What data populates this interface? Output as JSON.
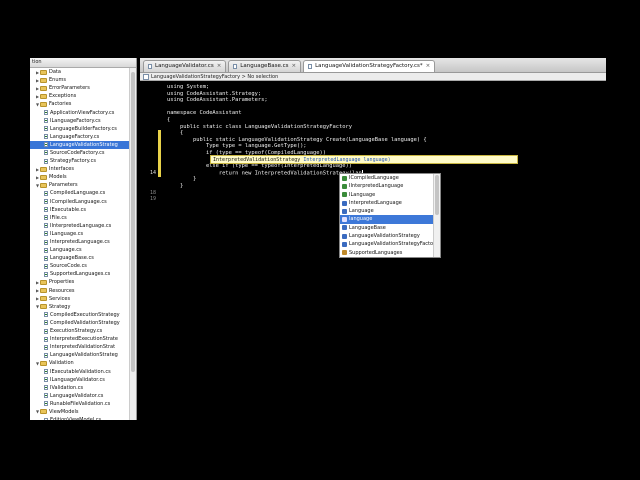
{
  "sidebar": {
    "header": "tion",
    "items": [
      {
        "label": "Data",
        "type": "folder",
        "indent": 1,
        "expander": "▶"
      },
      {
        "label": "Enums",
        "type": "folder",
        "indent": 1,
        "expander": "▶"
      },
      {
        "label": "ErrorParameters",
        "type": "folder",
        "indent": 1,
        "expander": "▶"
      },
      {
        "label": "Exceptions",
        "type": "folder",
        "indent": 1,
        "expander": "▶"
      },
      {
        "label": "Factories",
        "type": "folder",
        "indent": 1,
        "expander": "▼"
      },
      {
        "label": "ApplicationViewFactory.cs",
        "type": "file",
        "indent": 2
      },
      {
        "label": "ILanguageFactory.cs",
        "type": "file",
        "indent": 2
      },
      {
        "label": "LanguageBuilderFactory.cs",
        "type": "file",
        "indent": 2
      },
      {
        "label": "LanguageFactory.cs",
        "type": "file",
        "indent": 2
      },
      {
        "label": "LanguageValidationStrateg",
        "type": "file",
        "indent": 2,
        "selected": true
      },
      {
        "label": "SourceCodeFactory.cs",
        "type": "file",
        "indent": 2
      },
      {
        "label": "StrategyFactory.cs",
        "type": "file",
        "indent": 2
      },
      {
        "label": "Interfaces",
        "type": "folder",
        "indent": 1,
        "expander": "▶"
      },
      {
        "label": "Models",
        "type": "folder",
        "indent": 1,
        "expander": "▶"
      },
      {
        "label": "Parameters",
        "type": "folder",
        "indent": 1,
        "expander": "▼"
      },
      {
        "label": "CompiledLanguage.cs",
        "type": "file",
        "indent": 2
      },
      {
        "label": "ICompiledLanguage.cs",
        "type": "file",
        "indent": 2
      },
      {
        "label": "IExecutable.cs",
        "type": "file",
        "indent": 2
      },
      {
        "label": "IFile.cs",
        "type": "file",
        "indent": 2
      },
      {
        "label": "IInterpretedLanguage.cs",
        "type": "file",
        "indent": 2
      },
      {
        "label": "ILanguage.cs",
        "type": "file",
        "indent": 2
      },
      {
        "label": "InterpretedLanguage.cs",
        "type": "file",
        "indent": 2
      },
      {
        "label": "Language.cs",
        "type": "file",
        "indent": 2
      },
      {
        "label": "LanguageBase.cs",
        "type": "file",
        "indent": 2
      },
      {
        "label": "SourceCode.cs",
        "type": "file",
        "indent": 2
      },
      {
        "label": "SupportedLanguages.cs",
        "type": "file",
        "indent": 2
      },
      {
        "label": "Properties",
        "type": "folder",
        "indent": 1,
        "expander": "▶"
      },
      {
        "label": "Resources",
        "type": "folder",
        "indent": 1,
        "expander": "▶"
      },
      {
        "label": "Services",
        "type": "folder",
        "indent": 1,
        "expander": "▶"
      },
      {
        "label": "Strategy",
        "type": "folder",
        "indent": 1,
        "expander": "▼"
      },
      {
        "label": "CompiledExecutionStrategy",
        "type": "file",
        "indent": 2
      },
      {
        "label": "CompiledValidationStrategy",
        "type": "file",
        "indent": 2
      },
      {
        "label": "ExecutionStrategy.cs",
        "type": "file",
        "indent": 2
      },
      {
        "label": "InterpretedExecutionStrate",
        "type": "file",
        "indent": 2
      },
      {
        "label": "InterpretedValidationStrat",
        "type": "file",
        "indent": 2
      },
      {
        "label": "LanguageValidationStrateg",
        "type": "file",
        "indent": 2
      },
      {
        "label": "Validation",
        "type": "folder",
        "indent": 1,
        "expander": "▼"
      },
      {
        "label": "IExecutableValidation.cs",
        "type": "file",
        "indent": 2
      },
      {
        "label": "ILanguageValidator.cs",
        "type": "file",
        "indent": 2
      },
      {
        "label": "IValidation.cs",
        "type": "file",
        "indent": 2
      },
      {
        "label": "LanguageValidator.cs",
        "type": "file",
        "indent": 2
      },
      {
        "label": "RunableFileValidation.cs",
        "type": "file",
        "indent": 2
      },
      {
        "label": "ViewModels",
        "type": "folder",
        "indent": 1,
        "expander": "▼"
      },
      {
        "label": "EditionViewModel.cs",
        "type": "file",
        "indent": 2
      }
    ]
  },
  "tabs": [
    {
      "label": "LanguageValidator.cs",
      "active": false
    },
    {
      "label": "LanguageBase.cs",
      "active": false
    },
    {
      "label": "LanguageValidationStrategyFactory.cs*",
      "active": true
    }
  ],
  "pathbar": "LanguageValidationStrategyFactory > No selection",
  "editor": {
    "lines": [
      {
        "num": "",
        "text": "using System;",
        "mark": false
      },
      {
        "num": "",
        "text": "using CodeAssistant.Strategy;",
        "mark": false
      },
      {
        "num": "",
        "text": "using CodeAssistant.Parameters;",
        "mark": false
      },
      {
        "num": "",
        "text": "",
        "mark": false
      },
      {
        "num": "",
        "text": "namespace CodeAssistant",
        "mark": false
      },
      {
        "num": "",
        "text": "{",
        "mark": false
      },
      {
        "num": "",
        "text": "    public static class LanguageValidationStrategyFactory",
        "mark": false
      },
      {
        "num": "",
        "text": "    {",
        "mark": true
      },
      {
        "num": "",
        "text": "        public static LanguageValidationStrategy Create(LanguageBase language) {",
        "mark": true
      },
      {
        "num": "",
        "text": "            Type type = language.GetType();",
        "mark": true
      },
      {
        "num": "",
        "text": "            if (type == typeof(CompiledLanguage))",
        "mark": true
      },
      {
        "num": "",
        "text": "                return new CompiledValidationStrategy(lan",
        "mark": true
      },
      {
        "num": "",
        "text": "            else if (type == typeof(InterpretedLanguage))",
        "mark": true
      },
      {
        "num": "14",
        "text": "                return new InterpretedValidationStrategy(lan",
        "mark": true,
        "current": true
      },
      {
        "num": "",
        "text": "        }",
        "mark": false
      },
      {
        "num": "",
        "text": "    }",
        "mark": false
      },
      {
        "num": "18",
        "text": "",
        "mark": false
      },
      {
        "num": "19",
        "text": "",
        "mark": false
      }
    ]
  },
  "tooltip": {
    "main": "InterpretedValidationStrategy",
    "param": "InterpretedLanguage language)"
  },
  "autocomplete": [
    {
      "label": "ICompiledLanguage",
      "icon_color": "#3a8c3a"
    },
    {
      "label": "IInterpretedLanguage",
      "icon_color": "#3a8c3a"
    },
    {
      "label": "ILanguage",
      "icon_color": "#3a8c3a"
    },
    {
      "label": "InterpretedLanguage",
      "icon_color": "#3a6bc0"
    },
    {
      "label": "Language",
      "icon_color": "#3a6bc0"
    },
    {
      "label": "language",
      "icon_color": "#e0e0ff",
      "selected": true
    },
    {
      "label": "LanguageBase",
      "icon_color": "#3a6bc0"
    },
    {
      "label": "LanguageValidationStrategy",
      "icon_color": "#3a6bc0"
    },
    {
      "label": "LanguageValidationStrategyFactory",
      "icon_color": "#3a6bc0"
    },
    {
      "label": "SupportedLanguages",
      "icon_color": "#c08a2a"
    }
  ]
}
